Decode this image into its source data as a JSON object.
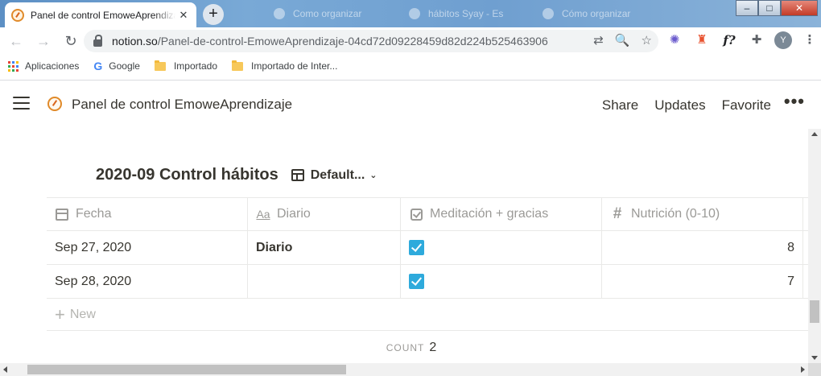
{
  "browser": {
    "active_tab": {
      "title": "Panel de control EmoweAprendizaje",
      "close": "✕"
    },
    "new_tab_label": "+",
    "background_tabs": [
      "Como organizar",
      "hábitos Syay - Es",
      "Cómo organizar"
    ],
    "window_controls": {
      "minimize": "–",
      "maximize": "□",
      "close": "✕"
    },
    "nav": {
      "back": "←",
      "forward": "→",
      "reload": "↻"
    },
    "url_host": "notion.so",
    "url_path": "/Panel-de-control-EmoweAprendizaje-04cd72d09228459d82d224b525463906",
    "omni_icons": {
      "translate": "⇄",
      "zoom": "🔍",
      "bookmark": "☆"
    },
    "extensions": {
      "gear": "✺",
      "fire": "♜",
      "f": "f?",
      "puzzle": "✚",
      "avatar": "Y",
      "menu": "⋮"
    }
  },
  "bookmarks": {
    "items": [
      {
        "label": "Aplicaciones",
        "icon": "apps-grid-icon"
      },
      {
        "label": "Google",
        "icon": "google-icon"
      },
      {
        "label": "Importado",
        "icon": "folder-icon"
      },
      {
        "label": "Importado de Inter...",
        "icon": "folder-icon"
      }
    ],
    "google_glyph": "G"
  },
  "notion": {
    "page_title": "Panel de control EmoweAprendizaje",
    "actions": {
      "share": "Share",
      "updates": "Updates",
      "favorite": "Favorite"
    },
    "more": "•••"
  },
  "database": {
    "title": "2020-09 Control hábitos",
    "view_name": "Default...",
    "columns": [
      {
        "label": "Fecha",
        "icon": "calendar-icon"
      },
      {
        "label": "Diario",
        "icon": "text-aa-icon"
      },
      {
        "label": "Meditación + gracias",
        "icon": "checkbox-icon"
      },
      {
        "label": "Nutrición (0-10)",
        "icon": "hash-icon"
      }
    ],
    "aa_glyph": "Aa",
    "hash_glyph": "#",
    "rows": [
      {
        "fecha": "Sep 27, 2020",
        "diario": "Diario",
        "meditacion": true,
        "nutricion": "8"
      },
      {
        "fecha": "Sep 28, 2020",
        "diario": "",
        "meditacion": true,
        "nutricion": "7"
      }
    ],
    "new_label": "New",
    "new_plus": "+",
    "count_label": "COUNT",
    "count_value": "2"
  },
  "colors": {
    "checkbox_blue": "#2eaadc",
    "text": "#37352f",
    "muted": "#9b9a97"
  }
}
